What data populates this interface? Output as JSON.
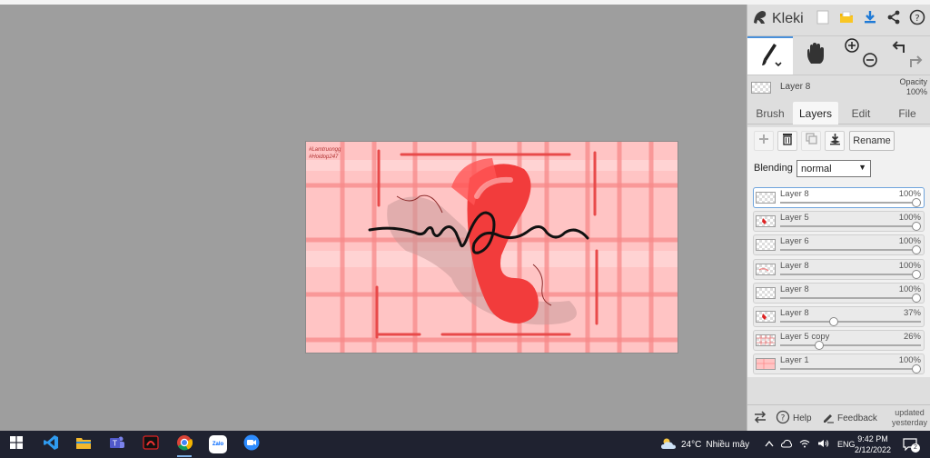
{
  "app": {
    "brand": "Kleki",
    "accent": "#4a90d9"
  },
  "canvas": {
    "watermark_1": "#Lamtruongg",
    "watermark_2": "#Hoidop247"
  },
  "header_icons": [
    "new-image-icon",
    "open-folder-icon",
    "download-icon",
    "share-icon",
    "help-icon"
  ],
  "tools": {
    "brush": "brush-icon",
    "hand": "hand-icon",
    "zoom_in": "zoom-in-icon",
    "zoom_out": "zoom-out-icon",
    "undo": "undo-icon",
    "redo": "redo-icon"
  },
  "current_layer": {
    "name": "Layer 8",
    "opacity_label": "Opacity",
    "opacity_value": "100%"
  },
  "tabs": [
    {
      "label": "Brush",
      "active": false
    },
    {
      "label": "Layers",
      "active": true
    },
    {
      "label": "Edit",
      "active": false
    },
    {
      "label": "File",
      "active": false
    }
  ],
  "layer_tools": {
    "rename_label": "Rename"
  },
  "blending": {
    "label": "Blending",
    "value": "normal"
  },
  "layers": [
    {
      "name": "Layer 8",
      "opacity": "100%",
      "value": 1.0,
      "selected": true,
      "thumb": "blank"
    },
    {
      "name": "Layer 5",
      "opacity": "100%",
      "value": 1.0,
      "selected": false,
      "thumb": "red-mark"
    },
    {
      "name": "Layer 6",
      "opacity": "100%",
      "value": 1.0,
      "selected": false,
      "thumb": "blank"
    },
    {
      "name": "Layer 8",
      "opacity": "100%",
      "value": 1.0,
      "selected": false,
      "thumb": "pink-mark"
    },
    {
      "name": "Layer 8",
      "opacity": "100%",
      "value": 1.0,
      "selected": false,
      "thumb": "blank"
    },
    {
      "name": "Layer 8",
      "opacity": "37%",
      "value": 0.37,
      "selected": false,
      "thumb": "red-mark"
    },
    {
      "name": "Layer 5 copy",
      "opacity": "26%",
      "value": 0.26,
      "selected": false,
      "thumb": "grid"
    },
    {
      "name": "Layer 1",
      "opacity": "100%",
      "value": 1.0,
      "selected": false,
      "thumb": "pink-grid"
    }
  ],
  "footer": {
    "help_label": "Help",
    "feedback_label": "Feedback",
    "updated_line1": "updated",
    "updated_line2": "yesterday"
  },
  "taskbar": {
    "apps": [
      "windows-start-icon",
      "vscode-icon",
      "file-explorer-icon",
      "teams-icon",
      "garena-icon",
      "chrome-icon",
      "zalo-icon",
      "zoom-icon"
    ],
    "zalo_label": "Zalo",
    "weather_temp": "24°C",
    "weather_desc": "Nhiều mây",
    "language": "ENG",
    "time": "9:42 PM",
    "date": "2/12/2022",
    "notifications": "2"
  }
}
